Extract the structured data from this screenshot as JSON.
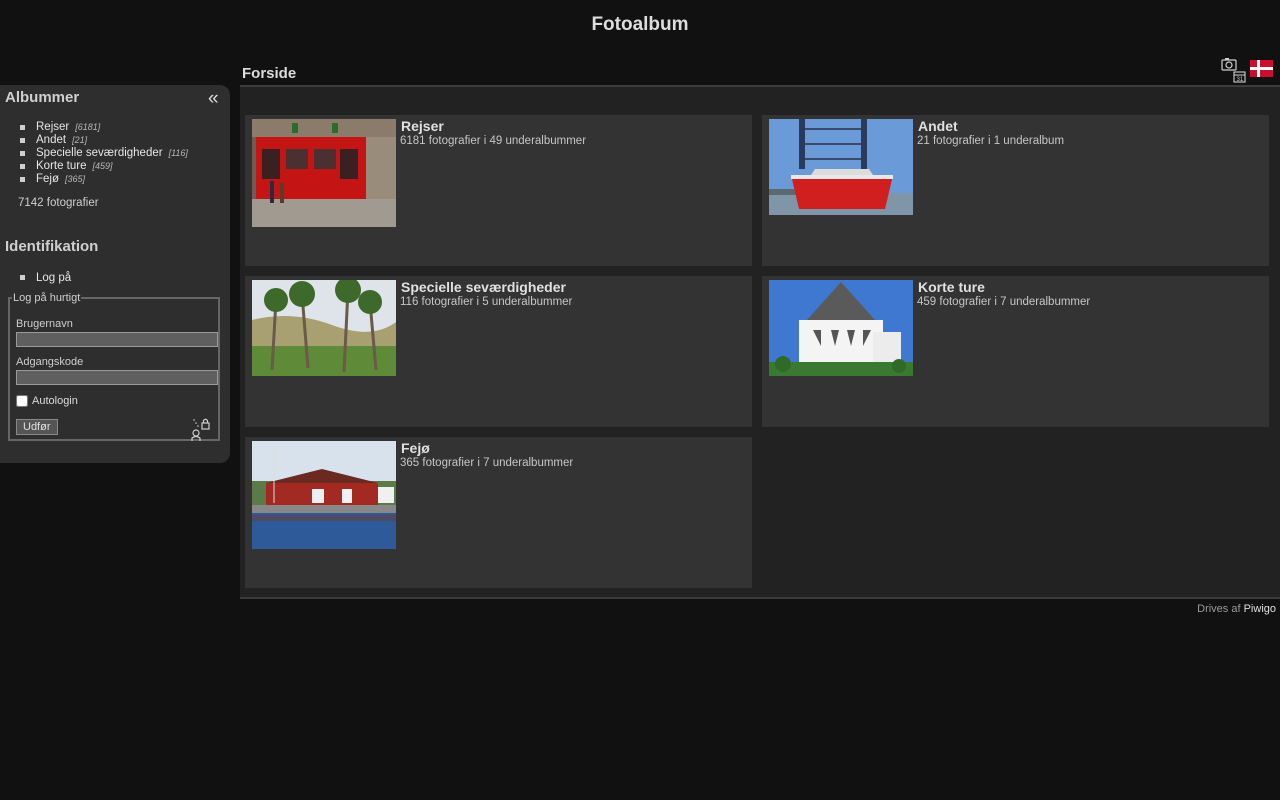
{
  "site_title": "Fotoalbum",
  "breadcrumb": "Forside",
  "menubar": {
    "albums_title": "Albummer",
    "collapse_glyph": "«",
    "albums": [
      {
        "label": "Rejser",
        "count": "[6181]"
      },
      {
        "label": "Andet",
        "count": "[21]"
      },
      {
        "label": "Specielle seværdigheder",
        "count": "[116]"
      },
      {
        "label": "Korte ture",
        "count": "[459]"
      },
      {
        "label": "Fejø",
        "count": "[365]"
      }
    ],
    "total_photos": "7142 fotografier",
    "identification_title": "Identifikation",
    "login_link": "Log på",
    "quickconnect": {
      "legend": "Log på hurtigt",
      "username_label": "Brugernavn",
      "password_label": "Adgangskode",
      "autologin_label": "Autologin",
      "submit_label": "Udfør"
    }
  },
  "toolbar_icons": [
    "calendar-camera-icon",
    "danish-flag-icon"
  ],
  "albums": [
    {
      "title": "Rejser",
      "desc": "6181 fotografier i 49 underalbummer",
      "thumb": "red-pub-facade"
    },
    {
      "title": "Andet",
      "desc": "21 fotografier i 1 underalbum",
      "thumb": "red-oil-rig"
    },
    {
      "title": "Specielle seværdigheder",
      "desc": "116 fotografier i 5 underalbummer",
      "thumb": "palm-trees"
    },
    {
      "title": "Korte ture",
      "desc": "459 fotografier i 7 underalbummer",
      "thumb": "round-church"
    },
    {
      "title": "Fejø",
      "desc": "365 fotografier i 7 underalbummer",
      "thumb": "red-boathouse"
    }
  ],
  "footer": {
    "prefix": "Drives af",
    "link": "Piwigo"
  }
}
